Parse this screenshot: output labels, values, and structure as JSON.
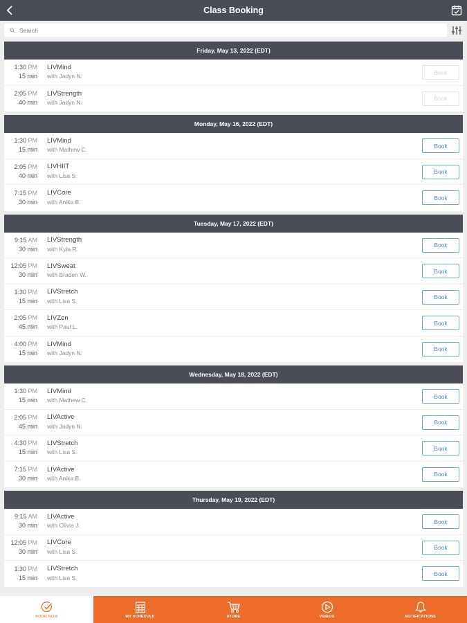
{
  "header": {
    "title": "Class Booking",
    "back_icon": "chevron-left-icon",
    "calendar_icon": "calendar-check-icon"
  },
  "search": {
    "placeholder": "Search",
    "icon": "search-icon",
    "filter_icon": "sliders-icon"
  },
  "days": [
    {
      "date": "Friday, May 13, 2022 (EDT)",
      "classes": [
        {
          "time": "1:30",
          "ampm": "PM",
          "duration": "15 min",
          "name": "LIVMind",
          "instructor": "with Jadyn N.",
          "book": "Book",
          "disabled": true
        },
        {
          "time": "2:05",
          "ampm": "PM",
          "duration": "40 min",
          "name": "LIVStrength",
          "instructor": "with Jadyn N.",
          "book": "Book",
          "disabled": true
        }
      ]
    },
    {
      "date": "Monday, May 16, 2022 (EDT)",
      "classes": [
        {
          "time": "1:30",
          "ampm": "PM",
          "duration": "15 min",
          "name": "LIVMind",
          "instructor": "with Mathew C.",
          "book": "Book",
          "disabled": false
        },
        {
          "time": "2:05",
          "ampm": "PM",
          "duration": "40 min",
          "name": "LIVHIIT",
          "instructor": "with Lisa S.",
          "book": "Book",
          "disabled": false
        },
        {
          "time": "7:15",
          "ampm": "PM",
          "duration": "30 min",
          "name": "LIVCore",
          "instructor": "with Anika B.",
          "book": "Book",
          "disabled": false
        }
      ]
    },
    {
      "date": "Tuesday, May 17, 2022 (EDT)",
      "classes": [
        {
          "time": "9:15",
          "ampm": "AM",
          "duration": "30 min",
          "name": "LIVStrength",
          "instructor": "with Kyla R.",
          "book": "Book",
          "disabled": false
        },
        {
          "time": "12:05",
          "ampm": "PM",
          "duration": "30 min",
          "name": "LIVSweat",
          "instructor": "with Braden W.",
          "book": "Book",
          "disabled": false
        },
        {
          "time": "1:30",
          "ampm": "PM",
          "duration": "15 min",
          "name": "LIVStretch",
          "instructor": "with Lisa S.",
          "book": "Book",
          "disabled": false
        },
        {
          "time": "2:05",
          "ampm": "PM",
          "duration": "45 min",
          "name": "LIVZen",
          "instructor": "with Paul L.",
          "book": "Book",
          "disabled": false
        },
        {
          "time": "4:00",
          "ampm": "PM",
          "duration": "15 min",
          "name": "LIVMind",
          "instructor": "with Jadyn N.",
          "book": "Book",
          "disabled": false
        }
      ]
    },
    {
      "date": "Wednesday, May 18, 2022 (EDT)",
      "classes": [
        {
          "time": "1:30",
          "ampm": "PM",
          "duration": "15 min",
          "name": "LIVMind",
          "instructor": "with Mathew C.",
          "book": "Book",
          "disabled": false
        },
        {
          "time": "2:05",
          "ampm": "PM",
          "duration": "45 min",
          "name": "LIVActive",
          "instructor": "with Jadyn N.",
          "book": "Book",
          "disabled": false
        },
        {
          "time": "4:30",
          "ampm": "PM",
          "duration": "15 min",
          "name": "LIVStretch",
          "instructor": "with Lisa S.",
          "book": "Book",
          "disabled": false
        },
        {
          "time": "7:15",
          "ampm": "PM",
          "duration": "30 min",
          "name": "LIVActive",
          "instructor": "with Anika B.",
          "book": "Book",
          "disabled": false
        }
      ]
    },
    {
      "date": "Thursday, May 19, 2022 (EDT)",
      "classes": [
        {
          "time": "9:15",
          "ampm": "AM",
          "duration": "30 min",
          "name": "LIVActive",
          "instructor": "with Olivia J.",
          "book": "Book",
          "disabled": false
        },
        {
          "time": "12:05",
          "ampm": "PM",
          "duration": "30 min",
          "name": "LIVCore",
          "instructor": "with Lisa S.",
          "book": "Book",
          "disabled": false
        },
        {
          "time": "1:30",
          "ampm": "PM",
          "duration": "15 min",
          "name": "LIVStretch",
          "instructor": "with Lisa S.",
          "book": "Book",
          "disabled": false
        }
      ]
    }
  ],
  "tabs": [
    {
      "label": "BOOK NOW",
      "icon": "check-circle-icon",
      "active": true
    },
    {
      "label": "MY SCHEDULE",
      "icon": "calendar-grid-icon",
      "active": false
    },
    {
      "label": "STORE",
      "icon": "shopping-cart-icon",
      "active": false
    },
    {
      "label": "VIDEOS",
      "icon": "play-circle-icon",
      "active": false
    },
    {
      "label": "NOTIFICATIONS",
      "icon": "bell-icon",
      "active": false
    }
  ],
  "colors": {
    "header_bg": "#4a4d55",
    "accent_orange": "#ee6c2a",
    "book_blue": "#4a88cc"
  }
}
